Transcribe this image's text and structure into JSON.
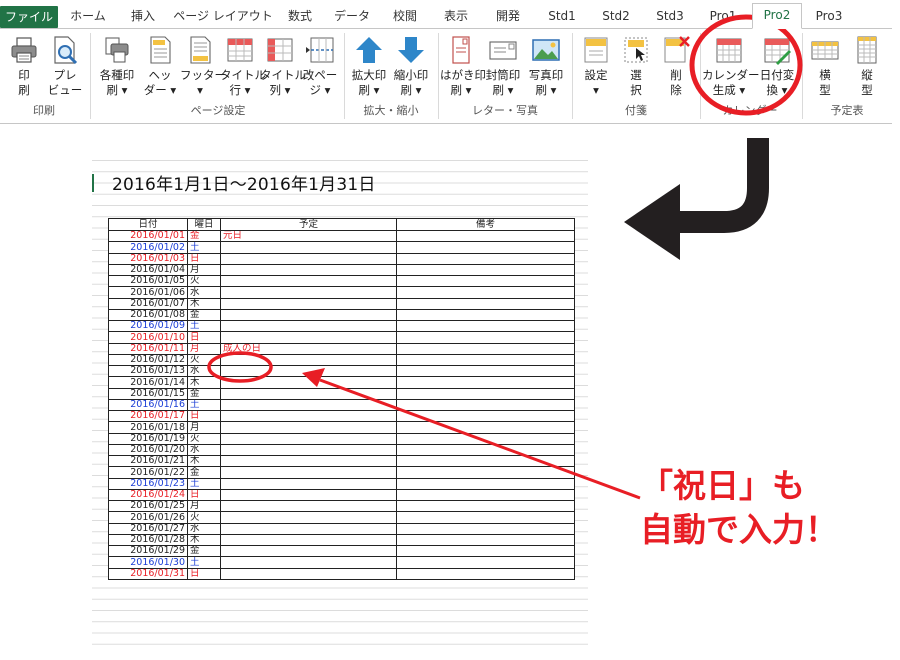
{
  "ribbon": {
    "tabs": [
      "ファイル",
      "ホーム",
      "挿入",
      "ページ レイアウト",
      "数式",
      "データ",
      "校閲",
      "表示",
      "開発",
      "Std1",
      "Std2",
      "Std3",
      "Pro1",
      "Pro2",
      "Pro3"
    ],
    "active_tab": "Pro2",
    "groups": [
      {
        "label": "印刷",
        "buttons": [
          {
            "line1": "印",
            "line2": "刷",
            "icon": "printer-icon"
          },
          {
            "line1": "プレ",
            "line2": "ビュー",
            "icon": "preview-icon"
          }
        ]
      },
      {
        "label": "ページ設定",
        "buttons": [
          {
            "line1": "各種印",
            "line2": "刷 ▾",
            "icon": "multi-print-icon"
          },
          {
            "line1": "ヘッ",
            "line2": "ダー ▾",
            "icon": "header-icon"
          },
          {
            "line1": "フッター",
            "line2": "▾",
            "icon": "footer-icon"
          },
          {
            "line1": "タイトル",
            "line2": "行 ▾",
            "icon": "title-row-icon"
          },
          {
            "line1": "タイトル",
            "line2": "列 ▾",
            "icon": "title-column-icon"
          },
          {
            "line1": "改ペー",
            "line2": "ジ ▾",
            "icon": "page-break-icon"
          }
        ]
      },
      {
        "label": "拡大・縮小",
        "buttons": [
          {
            "line1": "拡大印",
            "line2": "刷 ▾",
            "icon": "arrow-up-icon"
          },
          {
            "line1": "縮小印",
            "line2": "刷 ▾",
            "icon": "arrow-down-icon"
          }
        ]
      },
      {
        "label": "レター・写真",
        "buttons": [
          {
            "line1": "はがき印",
            "line2": "刷 ▾",
            "icon": "postcard-icon"
          },
          {
            "line1": "封筒印",
            "line2": "刷 ▾",
            "icon": "envelope-icon"
          },
          {
            "line1": "写真印",
            "line2": "刷 ▾",
            "icon": "photo-icon"
          }
        ]
      },
      {
        "label": "付箋",
        "buttons": [
          {
            "line1": "設定",
            "line2": "▾",
            "icon": "sticky-note-icon"
          },
          {
            "line1": "選",
            "line2": "択",
            "icon": "select-note-icon"
          },
          {
            "line1": "削",
            "line2": "除",
            "icon": "delete-note-icon"
          }
        ]
      },
      {
        "label": "カレンダー",
        "buttons": [
          {
            "line1": "カレンダー",
            "line2": "生成 ▾",
            "icon": "calendar-generate-icon"
          },
          {
            "line1": "日付変",
            "line2": "換 ▾",
            "icon": "date-convert-icon"
          }
        ]
      },
      {
        "label": "予定表",
        "buttons": [
          {
            "line1": "横",
            "line2": "型",
            "icon": "horizontal-schedule-icon"
          },
          {
            "line1": "縦",
            "line2": "型",
            "icon": "vertical-schedule-icon"
          }
        ]
      }
    ]
  },
  "sheet": {
    "title": "2016年1月1日～2016年1月31日",
    "headers": [
      "日付",
      "曜日",
      "予定",
      "備考"
    ],
    "rows": [
      {
        "date": "2016/01/01",
        "dow": "金",
        "color": "red",
        "event": "元日"
      },
      {
        "date": "2016/01/02",
        "dow": "土",
        "color": "blue",
        "event": ""
      },
      {
        "date": "2016/01/03",
        "dow": "日",
        "color": "red",
        "event": ""
      },
      {
        "date": "2016/01/04",
        "dow": "月",
        "color": "black",
        "event": ""
      },
      {
        "date": "2016/01/05",
        "dow": "火",
        "color": "black",
        "event": ""
      },
      {
        "date": "2016/01/06",
        "dow": "水",
        "color": "black",
        "event": ""
      },
      {
        "date": "2016/01/07",
        "dow": "木",
        "color": "black",
        "event": ""
      },
      {
        "date": "2016/01/08",
        "dow": "金",
        "color": "black",
        "event": ""
      },
      {
        "date": "2016/01/09",
        "dow": "土",
        "color": "blue",
        "event": ""
      },
      {
        "date": "2016/01/10",
        "dow": "日",
        "color": "red",
        "event": ""
      },
      {
        "date": "2016/01/11",
        "dow": "月",
        "color": "red",
        "event": "成人の日"
      },
      {
        "date": "2016/01/12",
        "dow": "火",
        "color": "black",
        "event": ""
      },
      {
        "date": "2016/01/13",
        "dow": "水",
        "color": "black",
        "event": ""
      },
      {
        "date": "2016/01/14",
        "dow": "木",
        "color": "black",
        "event": ""
      },
      {
        "date": "2016/01/15",
        "dow": "金",
        "color": "black",
        "event": ""
      },
      {
        "date": "2016/01/16",
        "dow": "土",
        "color": "blue",
        "event": ""
      },
      {
        "date": "2016/01/17",
        "dow": "日",
        "color": "red",
        "event": ""
      },
      {
        "date": "2016/01/18",
        "dow": "月",
        "color": "black",
        "event": ""
      },
      {
        "date": "2016/01/19",
        "dow": "火",
        "color": "black",
        "event": ""
      },
      {
        "date": "2016/01/20",
        "dow": "水",
        "color": "black",
        "event": ""
      },
      {
        "date": "2016/01/21",
        "dow": "木",
        "color": "black",
        "event": ""
      },
      {
        "date": "2016/01/22",
        "dow": "金",
        "color": "black",
        "event": ""
      },
      {
        "date": "2016/01/23",
        "dow": "土",
        "color": "blue",
        "event": ""
      },
      {
        "date": "2016/01/24",
        "dow": "日",
        "color": "red",
        "event": ""
      },
      {
        "date": "2016/01/25",
        "dow": "月",
        "color": "black",
        "event": ""
      },
      {
        "date": "2016/01/26",
        "dow": "火",
        "color": "black",
        "event": ""
      },
      {
        "date": "2016/01/27",
        "dow": "水",
        "color": "black",
        "event": ""
      },
      {
        "date": "2016/01/28",
        "dow": "木",
        "color": "black",
        "event": ""
      },
      {
        "date": "2016/01/29",
        "dow": "金",
        "color": "black",
        "event": ""
      },
      {
        "date": "2016/01/30",
        "dow": "土",
        "color": "blue",
        "event": ""
      },
      {
        "date": "2016/01/31",
        "dow": "日",
        "color": "red",
        "event": ""
      }
    ]
  },
  "callout": {
    "line1": "「祝日」も",
    "line2": "自動で入力！"
  },
  "colors": {
    "excel_green": "#217346",
    "holiday_red": "#e81e25",
    "saturday_blue": "#1a3dd6",
    "annotation_red": "#e81e25",
    "arrow_black": "#231f20"
  }
}
